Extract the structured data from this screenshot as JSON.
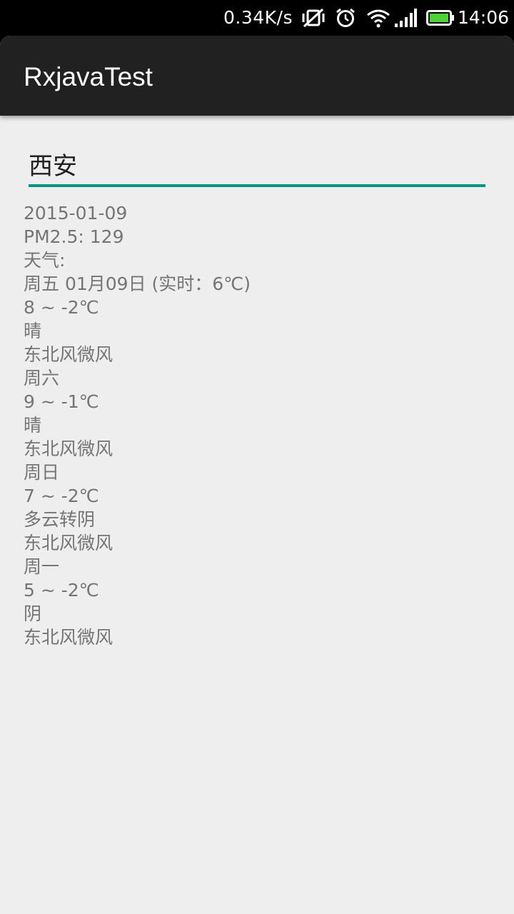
{
  "status_bar": {
    "net_speed": "0.34K/s",
    "time": "14:06",
    "icons": [
      "vibrate-off-icon",
      "alarm-clock-icon",
      "wifi-icon",
      "signal-icon",
      "battery-icon"
    ],
    "battery_color": "#4cd137"
  },
  "app": {
    "title": "RxjavaTest",
    "toolbar_color": "#212121",
    "accent_color": "#009688"
  },
  "city_input": {
    "value": "西安"
  },
  "weather": {
    "lines": [
      "2015-01-09",
      "PM2.5: 129",
      "天气:",
      "周五 01月09日 (实时：6℃)",
      "8 ~ -2℃",
      "晴",
      "东北风微风",
      "周六",
      "9 ~ -1℃",
      "晴",
      "东北风微风",
      "周日",
      "7 ~ -2℃",
      "多云转阴",
      "东北风微风",
      "周一",
      "5 ~ -2℃",
      "阴",
      "东北风微风"
    ]
  }
}
